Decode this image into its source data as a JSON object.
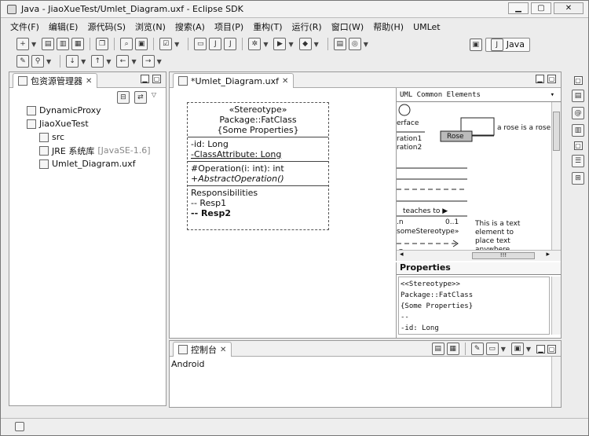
{
  "window": {
    "title": "Java - JiaoXueTest/Umlet_Diagram.uxf - Eclipse SDK"
  },
  "menus": [
    "文件(F)",
    "编辑(E)",
    "源代码(S)",
    "浏览(N)",
    "搜索(A)",
    "项目(P)",
    "重构(T)",
    "运行(R)",
    "窗口(W)",
    "帮助(H)",
    "UMLet"
  ],
  "perspective": {
    "label": "Java"
  },
  "package_explorer": {
    "tab": "包资源管理器",
    "items": [
      {
        "label": "DynamicProxy",
        "indent": 1
      },
      {
        "label": "JiaoXueTest",
        "indent": 1
      },
      {
        "label": "src",
        "indent": 2
      },
      {
        "label": "JRE 系统库",
        "suffix": "[JavaSE-1.6]",
        "indent": 2
      },
      {
        "label": "Umlet_Diagram.uxf",
        "indent": 2
      }
    ]
  },
  "editor": {
    "tab": "*Umlet_Diagram.uxf",
    "class": {
      "stereotype": "«Stereotype»",
      "name": "Package::FatClass",
      "props": "{Some Properties}",
      "attr1": "-id: Long",
      "attr2": "-ClassAttribute: Long",
      "op1": "#Operation(i: int): int",
      "op2": "+AbstractOperation()",
      "resp_title": "Responsibilities",
      "resp1": "-- Resp1",
      "resp2": "-- Resp2"
    }
  },
  "palette": {
    "title": "UML Common Elements",
    "iface": "erface",
    "op1": "ration1",
    "op2": "ration2",
    "rose": "Rose",
    "rose_note": "a rose is a rose",
    "teaches": "teaches to ▶",
    "mult_n": ".n",
    "mult_01": "0..1",
    "stereo": "someStereotype»",
    "note1": "This is a text",
    "note2": "element to",
    "note3": "place text",
    "note4": "anywhere.",
    "mult_n2": ".n",
    "scroll_thumb": "!!!"
  },
  "properties": {
    "title": "Properties",
    "lines": [
      "<<Stereotype>>",
      "Package::FatClass",
      "{Some Properties}",
      "--",
      "-id: Long"
    ]
  },
  "console": {
    "tab": "控制台",
    "content": "Android"
  }
}
